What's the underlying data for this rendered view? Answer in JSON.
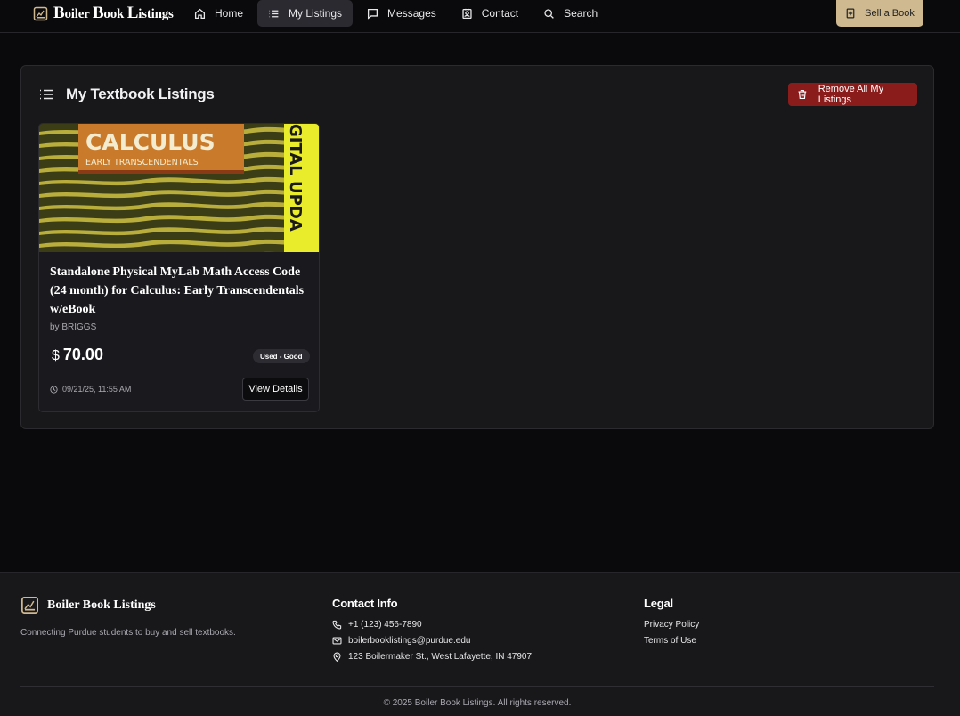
{
  "nav": {
    "brand": {
      "first_initial": "B",
      "first_rest": "oiler",
      "second_initial": "B",
      "second_rest": "ook",
      "third_initial": "L",
      "third_rest": "istings"
    },
    "links": [
      {
        "label": "Home",
        "icon": "home-icon"
      },
      {
        "label": "My Listings",
        "icon": "list-icon",
        "active": true
      },
      {
        "label": "Messages",
        "icon": "message-icon"
      },
      {
        "label": "Contact",
        "icon": "contact-icon"
      },
      {
        "label": "Search",
        "icon": "search-icon"
      }
    ],
    "sell_label": "Sell a Book"
  },
  "main": {
    "title": "My Textbook Listings",
    "remove_all_label": "Remove All My Listings",
    "listings": [
      {
        "title": "Standalone Physical MyLab Math Access Code (24 month) for Calculus: Early Transcendentals w/eBook",
        "author": "by BRIGGS",
        "currency": "$",
        "price": "70.00",
        "condition": "Used - Good",
        "posted": "09/21/25, 11:55 AM",
        "view_label": "View Details",
        "cover": {
          "title": "CALCULUS",
          "subtitle": "EARLY TRANSCENDENTALS",
          "side_text": "GITAL UPDA"
        }
      }
    ]
  },
  "footer": {
    "brand": "Boiler Book Listings",
    "tagline": "Connecting Purdue students to buy and sell textbooks.",
    "contact_title": "Contact Info",
    "phone": "+1 (123) 456-7890",
    "email": "boilerbooklistings@purdue.edu",
    "address": "123 Boilermaker St., West Lafayette, IN 47907",
    "legal_title": "Legal",
    "privacy": "Privacy Policy",
    "terms": "Terms of Use",
    "copyright": "© 2025 Boiler Book Listings. All rights reserved."
  },
  "colors": {
    "accent_gold": "#cfb991",
    "danger": "#8b1c1c",
    "background": "#0a0a0c",
    "panel": "#18181b"
  }
}
